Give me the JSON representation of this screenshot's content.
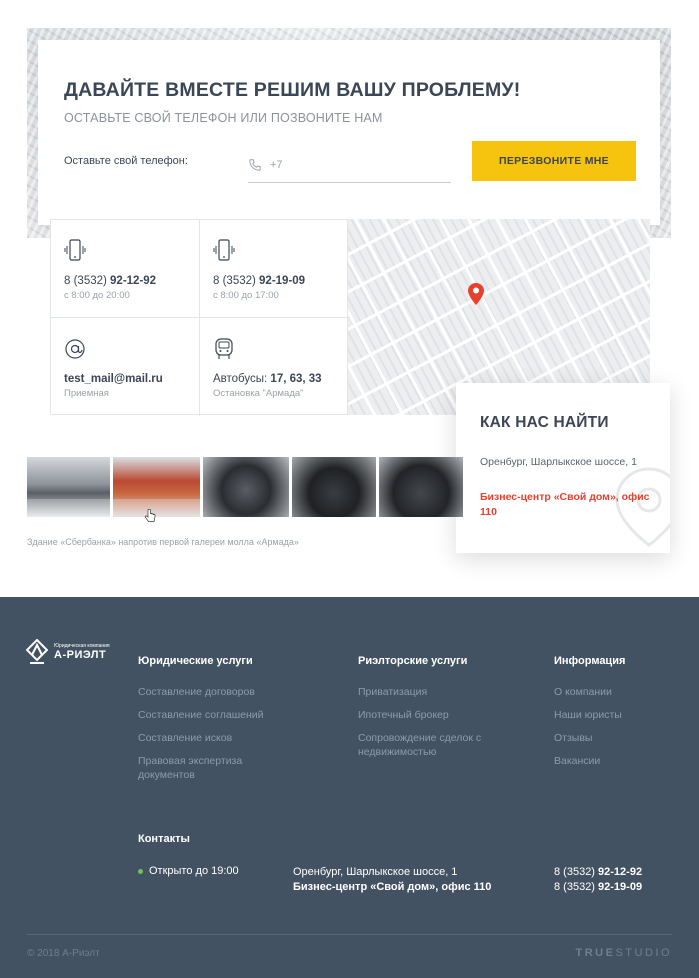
{
  "callback": {
    "title": "ДАВАЙТЕ ВМЕСТЕ РЕШИМ ВАШУ ПРОБЛЕМУ!",
    "subtitle": "ОСТАВЬТЕ СВОЙ ТЕЛЕФОН ИЛИ ПОЗВОНИТЕ НАМ",
    "phone_label": "Оставьте свой телефон:",
    "phone_value": "+7",
    "button_label": "ПЕРЕЗВОНИТЕ МНЕ",
    "button_color": "#f6c30f"
  },
  "contacts_grid": [
    {
      "icon": "phone-vibrate-icon",
      "prefix": "8 (3532) ",
      "bold": "92-12-92",
      "sub": "с 8:00 до 20:00"
    },
    {
      "icon": "phone-vibrate-icon",
      "prefix": "8 (3532) ",
      "bold": "92-19-09",
      "sub": "с 8:00 до 17:00"
    },
    {
      "icon": "at-icon",
      "prefix": "",
      "bold": "test_mail@mail.ru",
      "sub": "Приемная"
    },
    {
      "icon": "bus-icon",
      "prefix": "Автобусы: ",
      "bold": "17, 63, 33",
      "sub": "Остановка \"Армада\""
    }
  ],
  "find_us": {
    "title": "КАК НАС НАЙТИ",
    "address": "Оренбург, Шарлыкское шоссе, 1",
    "office": "Бизнес-центр «Свой дом», офис 110",
    "accent_color": "#e8402c"
  },
  "gallery": {
    "caption": "Здание «Сбербанка» напротив первой галереи молла «Армада»"
  },
  "footer": {
    "logo_small": "Юридическая компания",
    "logo_big": "А-РИЭЛТ",
    "columns": [
      {
        "title": "Юридические услуги",
        "links": [
          "Составление договоров",
          "Составление соглашений",
          "Составление исков",
          "Правовая экспертиза документов"
        ]
      },
      {
        "title": "Риэлторские услуги",
        "links": [
          "Приватизация",
          "Ипотечный брокер",
          "Сопровождение сделок с недвижимостью"
        ]
      },
      {
        "title": "Информация",
        "links": [
          "О компании",
          "Наши юристы",
          "Отзывы",
          "Вакансии"
        ]
      }
    ],
    "contacts_title": "Контакты",
    "open_status": "Открыто до 19:00",
    "address_line1": "Оренбург, Шарлыкское шоссе, 1",
    "address_line2": "Бизнес-центр «Свой дом», офис 110",
    "phone1_prefix": "8 (3532) ",
    "phone1_bold": "92-12-92",
    "phone2_prefix": "8 (3532) ",
    "phone2_bold": "92-19-09",
    "copyright": "© 2018 А-Риэлт",
    "studio_bold": "TRUE",
    "studio_rest": "STUDIO",
    "bg_color": "#435263"
  }
}
